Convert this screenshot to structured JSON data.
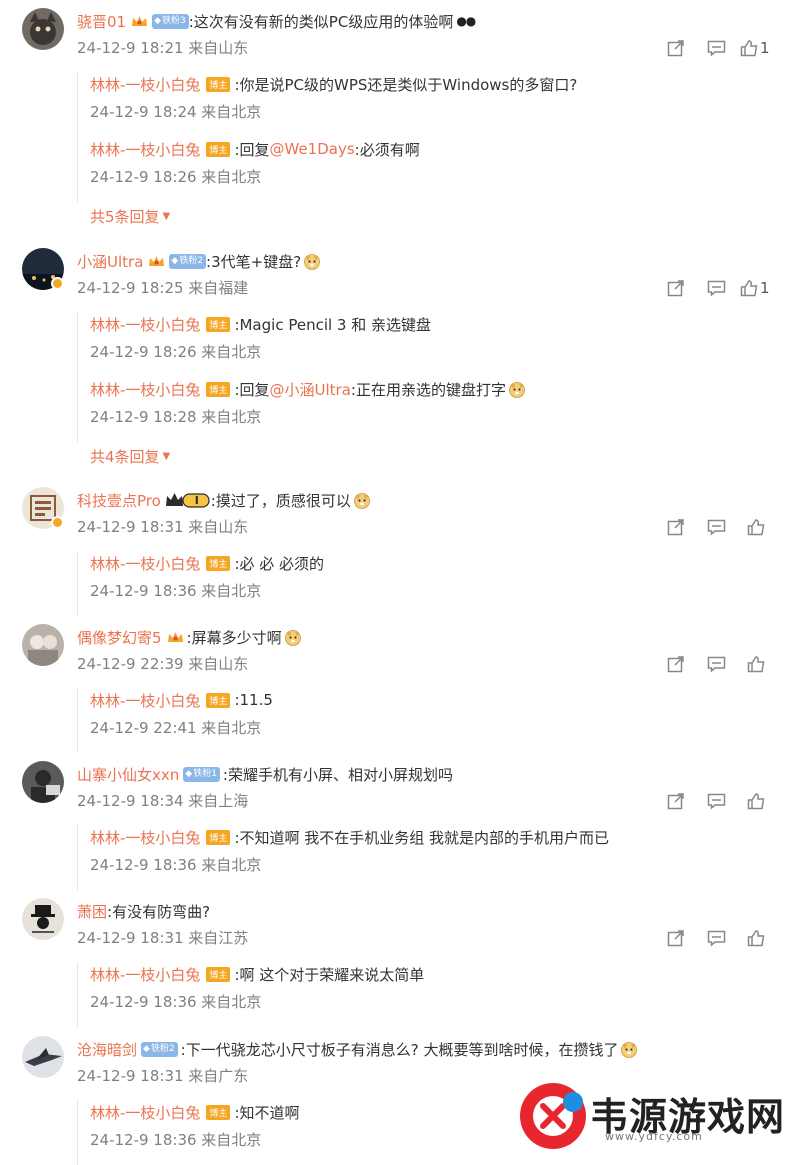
{
  "comments": [
    {
      "name": "骁晋01",
      "fan_label": "铁粉3",
      "text": ":这次有没有新的类似PC级应用的体验啊",
      "meta": "24-12-9 18:21 来自山东",
      "likes": "1",
      "replies": [
        {
          "name": "林林-一枝小白兔",
          "badge": "博主",
          "text": ":你是说PC级的WPS还是类似于Windows的多窗口?",
          "meta": "24-12-9 18:24 来自北京"
        },
        {
          "name": "林林-一枝小白兔",
          "badge": "博主",
          "pre": ":回复",
          "mention": "@We1Days",
          "text": ":必须有啊",
          "meta": "24-12-9 18:26 来自北京"
        }
      ],
      "more": "共5条回复"
    },
    {
      "name": "小涵Ultra",
      "fan_label": "铁粉2",
      "text": ":3代笔+键盘?",
      "meta": "24-12-9 18:25 来自福建",
      "likes": "1",
      "replies": [
        {
          "name": "林林-一枝小白兔",
          "badge": "博主",
          "text": ":Magic Pencil 3 和 亲选键盘",
          "meta": "24-12-9 18:26 来自北京"
        },
        {
          "name": "林林-一枝小白兔",
          "badge": "博主",
          "pre": ":回复",
          "mention": "@小涵Ultra",
          "text": ":正在用亲选的键盘打字",
          "meta": "24-12-9 18:28 来自北京"
        }
      ],
      "more": "共4条回复"
    },
    {
      "name": "科技壹点Pro",
      "level": "I",
      "text": ":摸过了，质感很可以",
      "meta": "24-12-9 18:31 来自山东",
      "replies": [
        {
          "name": "林林-一枝小白兔",
          "badge": "博主",
          "text": ":必 必 必须的",
          "meta": "24-12-9 18:36 来自北京"
        }
      ]
    },
    {
      "name": "偶像梦幻寄5",
      "text": ":屏幕多少寸啊",
      "meta": "24-12-9 22:39 来自山东",
      "replies": [
        {
          "name": "林林-一枝小白兔",
          "badge": "博主",
          "text": ":11.5",
          "meta": "24-12-9 22:41 来自北京"
        }
      ]
    },
    {
      "name": "山寨小仙女xxn",
      "fan_label": "铁粉1",
      "text": ":荣耀手机有小屏、相对小屏规划吗",
      "meta": "24-12-9 18:34 来自上海",
      "replies": [
        {
          "name": "林林-一枝小白兔",
          "badge": "博主",
          "text": ":不知道啊 我不在手机业务组 我就是内部的手机用户而已",
          "meta": "24-12-9 18:36 来自北京"
        }
      ]
    },
    {
      "name": "萧困",
      "text": ":有没有防弯曲?",
      "meta": "24-12-9 18:31 来自江苏",
      "replies": [
        {
          "name": "林林-一枝小白兔",
          "badge": "博主",
          "text": ":啊 这个对于荣耀来说太简单",
          "meta": "24-12-9 18:36 来自北京"
        }
      ]
    },
    {
      "name": "沧海暗剑",
      "fan_label": "铁粉2",
      "text": ":下一代骁龙芯小尺寸板子有消息么? 大概要等到啥时候，在攒钱了",
      "meta": "24-12-9 18:31 来自广东",
      "replies": [
        {
          "name": "林林-一枝小白兔",
          "badge": "博主",
          "text": ":知不道啊",
          "meta": "24-12-9 18:36 来自北京"
        }
      ]
    }
  ],
  "watermark": {
    "text": "韦源游戏网",
    "url": "www.ydfcy.com"
  },
  "colors": {
    "username": "#eb7350",
    "meta": "#808080",
    "bozhu_badge": "#f5a623",
    "fan_badge": "#8ab6e8"
  },
  "icons": {
    "share": "share-icon",
    "comment": "comment-icon",
    "like": "thumbs-up-icon",
    "expand": "chevron-down-icon"
  }
}
